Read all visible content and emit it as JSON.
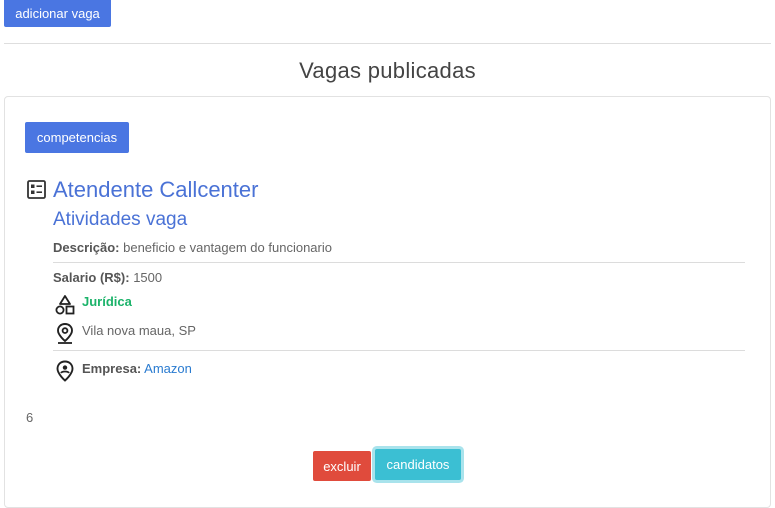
{
  "toolbar": {
    "add_label": "adicionar vaga"
  },
  "page": {
    "title": "Vagas publicadas"
  },
  "job": {
    "competencias_label": "competencias",
    "title": "Atendente Callcenter",
    "subtitle": "Atividades vaga",
    "descricao_label": "Descrição:",
    "descricao_value": "beneficio e vantagem do funcionario",
    "salario_label": "Salario (R$):",
    "salario_value": "1500",
    "tipo": "Jurídica",
    "local": "Vila nova maua, SP",
    "empresa_label": "Empresa:",
    "empresa_value": "Amazon",
    "count": "6",
    "delete_label": "excluir",
    "candidates_label": "candidatos"
  },
  "colors": {
    "primary": "#4a76e2",
    "danger": "#e04b3c",
    "info": "#3bbfd3",
    "success_text": "#1bb36a",
    "link": "#2a7bd0"
  },
  "icons": {
    "job": "listing-icon",
    "type": "shapes-icon",
    "location": "map-pin-icon",
    "company": "person-pin-icon"
  }
}
